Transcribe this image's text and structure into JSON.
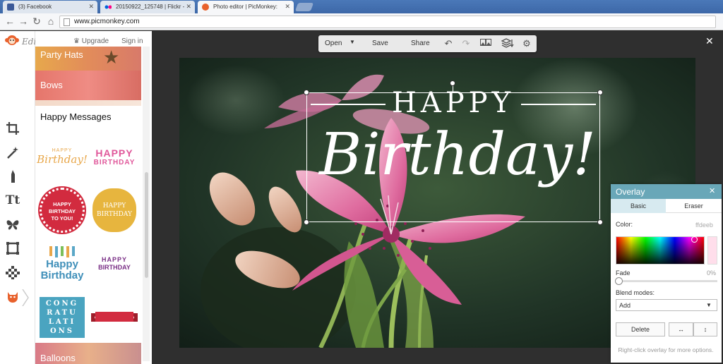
{
  "browser": {
    "tabs": [
      {
        "label": "(3) Facebook"
      },
      {
        "label": "20150922_125748 | Flickr -"
      },
      {
        "label": "Photo editor | PicMonkey:"
      }
    ],
    "url": "www.picmonkey.com"
  },
  "app": {
    "editor_label": "Editor",
    "upgrade": "Upgrade",
    "signin": "Sign in"
  },
  "panel": {
    "categories": [
      {
        "label": "Party Hats"
      },
      {
        "label": "Bows"
      },
      {
        "label": "Balloons"
      }
    ],
    "section_title": "Happy Messages"
  },
  "stickers": [
    {
      "l1": "HAPPY",
      "l2": "Birthday!"
    },
    {
      "l1": "HAPPY",
      "l2": "BIRTHDAY"
    },
    {
      "l1": "HAPPY",
      "l2": "BIRTHDAY",
      "l3": "TO YOU!"
    },
    {
      "l1": "HAPPY",
      "l2": "BIRTHDAY"
    },
    {
      "l1": "Happy",
      "l2": "Birthday"
    },
    {
      "l1": "HAPPY",
      "l2": "BIRTHDAY"
    },
    {
      "l1": "CONG",
      "l2": "RATU",
      "l3": "LATI",
      "l4": "ONS"
    }
  ],
  "toolbar": {
    "open": "Open",
    "save": "Save",
    "share": "Share"
  },
  "canvas": {
    "text_line1": "HAPPY",
    "text_line2": "Birthday!"
  },
  "overlay_panel": {
    "title": "Overlay",
    "tab_basic": "Basic",
    "tab_eraser": "Eraser",
    "color_label": "Color:",
    "color_value": "ffdeeb",
    "fade_label": "Fade",
    "fade_value": "0%",
    "blend_label": "Blend modes:",
    "blend_value": "Add",
    "delete": "Delete",
    "hint": "Right-click overlay for more options."
  },
  "colors": {
    "accent": "#69a7b8",
    "swatch": "#ffdeeb",
    "brand": "#e8612c"
  }
}
